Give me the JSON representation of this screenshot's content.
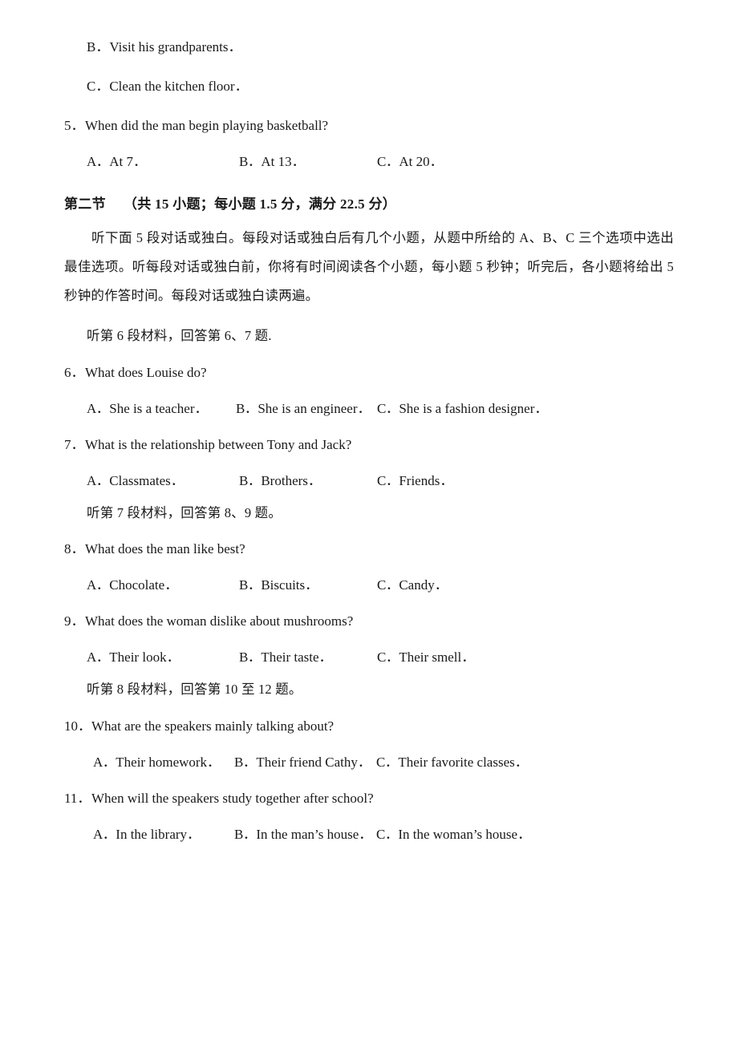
{
  "top_options": [
    {
      "mark": "B．",
      "text": "Visit his grandparents．"
    },
    {
      "mark": "C．",
      "text": "Clean the kitchen floor．"
    }
  ],
  "question5": {
    "number": "5．",
    "text": "When did the man begin playing basketball?",
    "options": [
      {
        "mark": "A．",
        "text": "At 7．"
      },
      {
        "mark": "B．",
        "text": "At 13．"
      },
      {
        "mark": "C．",
        "text": "At 20．"
      }
    ]
  },
  "section": {
    "title": "第二节",
    "score_note": "（共 15 小题；每小题 1.5 分，满分 22.5 分）",
    "instructions": "听下面 5 段对话或独白。每段对话或独白后有几个小题，从题中所给的 A、B、C 三个选项中选出最佳选项。听每段对话或独白前，你将有时间阅读各个小题，每小题 5 秒钟；听完后，各小题将给出 5 秒钟的作答时间。每段对话或独白读两遍。"
  },
  "segments": {
    "six": "听第 6 段材料，回答第 6、7 题.",
    "seven": "听第 7 段材料，回答第 8、9 题。",
    "eight": "听第 8 段材料，回答第 10 至 12 题。"
  },
  "question6": {
    "number": "6．",
    "text": "What does Louise do?",
    "options": [
      {
        "mark": "A．",
        "text": "She is a teacher．"
      },
      {
        "mark": "B．",
        "text": "She is an engineer．"
      },
      {
        "mark": "C．",
        "text": "She is a fashion designer．"
      }
    ]
  },
  "question7": {
    "number": "7．",
    "text": "What is the relationship between Tony and Jack?",
    "options": [
      {
        "mark": "A．",
        "text": "Classmates．"
      },
      {
        "mark": "B．",
        "text": "Brothers．"
      },
      {
        "mark": "C．",
        "text": "Friends．"
      }
    ]
  },
  "question8": {
    "number": "8．",
    "text": "What does the man like best?",
    "options": [
      {
        "mark": "A．",
        "text": "Chocolate．"
      },
      {
        "mark": "B．",
        "text": "Biscuits．"
      },
      {
        "mark": "C．",
        "text": "Candy．"
      }
    ]
  },
  "question9": {
    "number": "9．",
    "text": "What does the woman dislike about mushrooms?",
    "options": [
      {
        "mark": "A．",
        "text": "Their look．"
      },
      {
        "mark": "B．",
        "text": "Their taste．"
      },
      {
        "mark": "C．",
        "text": "Their smell．"
      }
    ]
  },
  "question10": {
    "number": "10．",
    "text": "What are the speakers mainly talking about?",
    "options": [
      {
        "mark": "A．",
        "text": "Their homework．"
      },
      {
        "mark": "B．",
        "text": "Their friend Cathy．"
      },
      {
        "mark": "C．",
        "text": "Their favorite classes．"
      }
    ]
  },
  "question11": {
    "number": "11．",
    "text": "When will the speakers study together after school?",
    "options": [
      {
        "mark": "A．",
        "text": "In the library．"
      },
      {
        "mark": "B．",
        "text": "In the man’s house．"
      },
      {
        "mark": "C．",
        "text": "In the woman’s house．"
      }
    ]
  }
}
